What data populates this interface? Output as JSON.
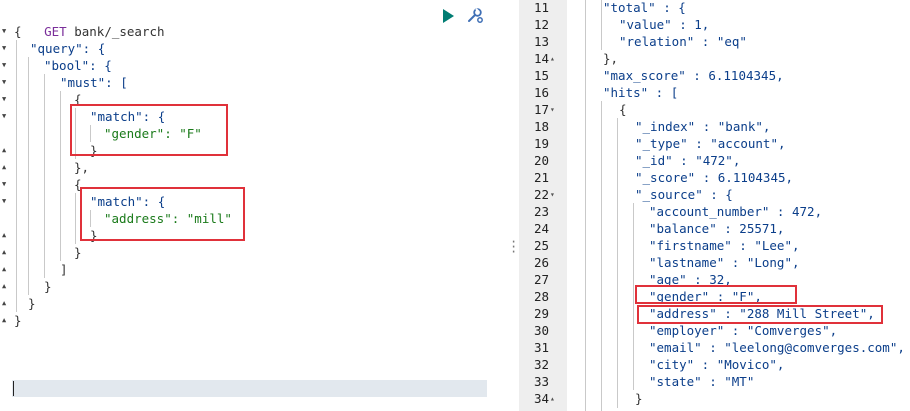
{
  "request": {
    "method": "GET",
    "path": "bank/_search",
    "lines": [
      "{",
      "\"query\": {",
      "\"bool\": {",
      "\"must\": [",
      "{",
      "\"match\": {",
      "\"gender\": \"F\"",
      "}",
      "},",
      "{",
      "\"match\": {",
      "\"address\": \"mill\"",
      "}",
      "}",
      "]",
      "}",
      "}",
      "}"
    ]
  },
  "response": {
    "line_numbers": [
      "11",
      "12",
      "13",
      "14",
      "15",
      "16",
      "17",
      "18",
      "19",
      "20",
      "21",
      "22",
      "23",
      "24",
      "25",
      "26",
      "27",
      "28",
      "29",
      "30",
      "31",
      "32",
      "33",
      "34"
    ],
    "lines": [
      "\"total\" : {",
      "\"value\" : 1,",
      "\"relation\" : \"eq\"",
      "},",
      "\"max_score\" : 6.1104345,",
      "\"hits\" : [",
      "{",
      "\"_index\" : \"bank\",",
      "\"_type\" : \"account\",",
      "\"_id\" : \"472\",",
      "\"_score\" : 6.1104345,",
      "\"_source\" : {",
      "\"account_number\" : 472,",
      "\"balance\" : 25571,",
      "\"firstname\" : \"Lee\",",
      "\"lastname\" : \"Long\",",
      "\"age\" : 32,",
      "\"gender\" : \"F\",",
      "\"address\" : \"288 Mill Street\",",
      "\"employer\" : \"Comverges\",",
      "\"email\" : \"leelong@comverges.com\",",
      "\"city\" : \"Movico\",",
      "\"state\" : \"MT\"",
      "}"
    ]
  },
  "icons": {
    "run": "play-icon",
    "settings": "wrench-icon",
    "resize": "grip-icon"
  },
  "colors": {
    "highlight_box": "#e0313a",
    "run_button": "#017d73",
    "string": "#1a7a1a",
    "key": "#0b3e8a"
  }
}
